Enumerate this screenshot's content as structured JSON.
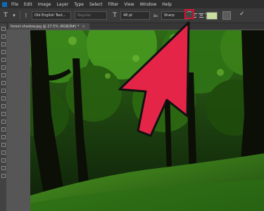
{
  "menubar": {
    "items": [
      "File",
      "Edit",
      "Image",
      "Layer",
      "Type",
      "Select",
      "Filter",
      "View",
      "Window",
      "Help"
    ]
  },
  "options": {
    "font_family": "Old English Text...",
    "font_style": "Regular",
    "font_size": "48 pt",
    "antialias": "Sharp"
  },
  "document": {
    "tab_title": "forest shadow.jpg @ 27.5% (RGB/8#) *",
    "close_glyph": "×"
  },
  "colors": {
    "highlight": "#e01030",
    "text_color_swatch": "#c8dfa0",
    "arrow_fill": "#e52548"
  },
  "icons": [
    "photoshop-logo",
    "type-tool-icon",
    "text-orientation-icon",
    "font-size-icon",
    "antialias-icon",
    "align-left-icon",
    "align-center-icon",
    "align-right-icon",
    "warp-text-icon",
    "character-panel-icon",
    "commit-check-icon"
  ]
}
